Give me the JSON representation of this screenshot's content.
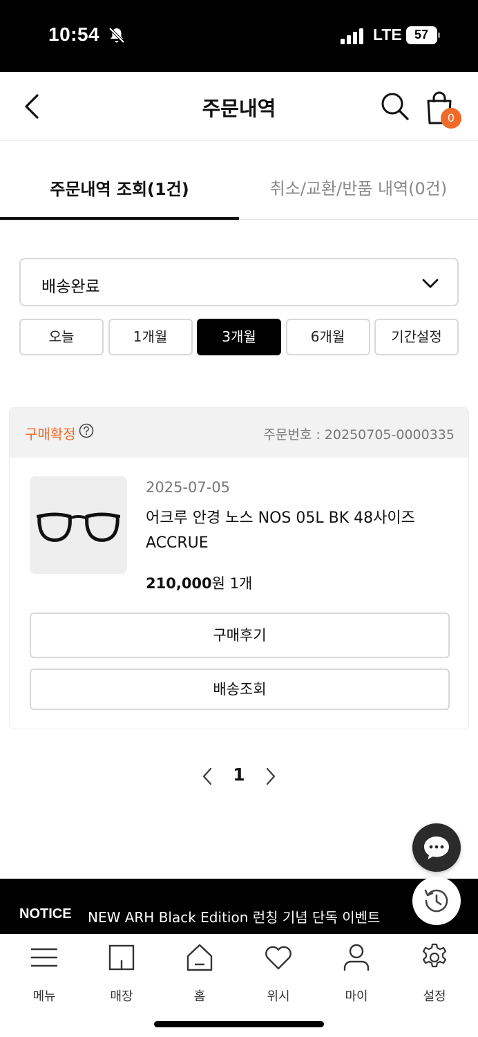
{
  "status_bar": {
    "time": "10:54",
    "network": "LTE",
    "battery": "57"
  },
  "header": {
    "title": "주문내역",
    "cart_count": "0"
  },
  "tabs": [
    {
      "label": "주문내역 조회(1건)",
      "active": true
    },
    {
      "label": "취소/교환/반품 내역(0건)",
      "active": false
    }
  ],
  "filter": {
    "status_value": "배송완료",
    "periods": [
      "오늘",
      "1개월",
      "3개월",
      "6개월",
      "기간설정"
    ],
    "selected_period": "3개월"
  },
  "order": {
    "status_label": "구매확정",
    "order_number": "주문번호 : 20250705-0000335",
    "date": "2025-07-05",
    "product_name": "어크루 안경 노스 NOS 05L BK 48사이즈 ACCRUE",
    "price": "210,000",
    "price_unit": "원",
    "quantity": "1개",
    "review_button": "구매후기",
    "tracking_button": "배송조회"
  },
  "pagination": {
    "current": "1"
  },
  "notice": {
    "label": "NOTICE",
    "text": "NEW ARH Black Edition 런칭 기념 단독 이벤트"
  },
  "bottom_nav": [
    "메뉴",
    "매장",
    "홈",
    "위시",
    "마이",
    "설정"
  ],
  "colors": {
    "accent": "#f06a2a",
    "selected_period_bg": "#000000"
  },
  "icons": {
    "header": [
      "back-arrow-icon",
      "search-icon",
      "shopping-bag-icon"
    ],
    "floating": [
      "chat-icon",
      "history-icon"
    ],
    "nav": [
      "menu-icon",
      "store-icon",
      "home-icon",
      "heart-icon",
      "person-icon",
      "gear-icon"
    ]
  }
}
